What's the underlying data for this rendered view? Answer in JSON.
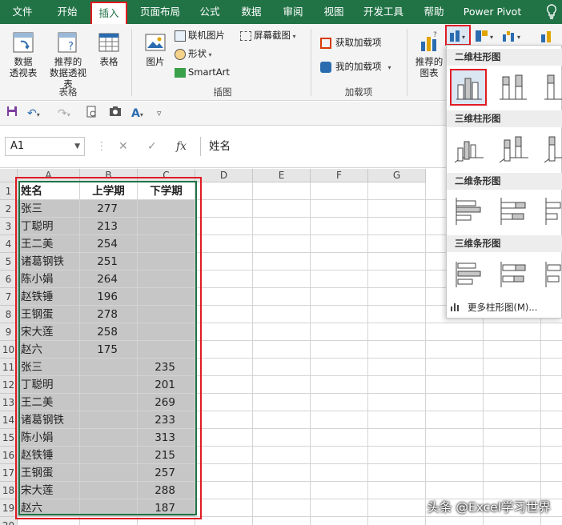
{
  "tabs": [
    "文件",
    "开始",
    "插入",
    "页面布局",
    "公式",
    "数据",
    "审阅",
    "视图",
    "开发工具",
    "帮助",
    "Power Pivot"
  ],
  "active_tab": "插入",
  "ribbon": {
    "table_group": {
      "pivot": "数据\n透视表",
      "recommended_pivot": "推荐的\n数据透视表",
      "table": "表格",
      "label": "表格"
    },
    "illus_group": {
      "picture": "图片",
      "online_picture": "联机图片",
      "shapes": "形状",
      "smartart": "SmartArt",
      "screenshot": "屏幕截图",
      "label": "插图"
    },
    "addins_group": {
      "get_addins": "获取加载项",
      "my_addins": "我的加载项",
      "label": "加载项"
    },
    "charts_group": {
      "recommended_charts": "推荐的\n图表"
    }
  },
  "name_box": "A1",
  "formula_value": "姓名",
  "columns": [
    "A",
    "B",
    "C",
    "D",
    "E",
    "F",
    "G"
  ],
  "header_row": [
    "姓名",
    "上学期",
    "下学期"
  ],
  "rows": [
    [
      "张三",
      "277",
      ""
    ],
    [
      "丁聪明",
      "213",
      ""
    ],
    [
      "王二美",
      "254",
      ""
    ],
    [
      "诸葛钢铁",
      "251",
      ""
    ],
    [
      "陈小娟",
      "264",
      ""
    ],
    [
      "赵铁锤",
      "196",
      ""
    ],
    [
      "王钢蛋",
      "278",
      ""
    ],
    [
      "宋大莲",
      "258",
      ""
    ],
    [
      "赵六",
      "175",
      ""
    ],
    [
      "张三",
      "",
      "235"
    ],
    [
      "丁聪明",
      "",
      "201"
    ],
    [
      "王二美",
      "",
      "269"
    ],
    [
      "诸葛钢铁",
      "",
      "233"
    ],
    [
      "陈小娟",
      "",
      "313"
    ],
    [
      "赵铁锤",
      "",
      "215"
    ],
    [
      "王钢蛋",
      "",
      "257"
    ],
    [
      "宋大莲",
      "",
      "288"
    ],
    [
      "赵六",
      "",
      "187"
    ]
  ],
  "chart_menu": {
    "sec_2d_col": "二维柱形图",
    "sec_3d_col": "三维柱形图",
    "sec_2d_bar": "二维条形图",
    "sec_3d_bar": "三维条形图",
    "more": "更多柱形图(M)..."
  },
  "watermark": "头条 @Excel学习世界",
  "colors": {
    "accent": "#217346",
    "highlight": "#e01c24",
    "selection": "#c6c6c6"
  }
}
